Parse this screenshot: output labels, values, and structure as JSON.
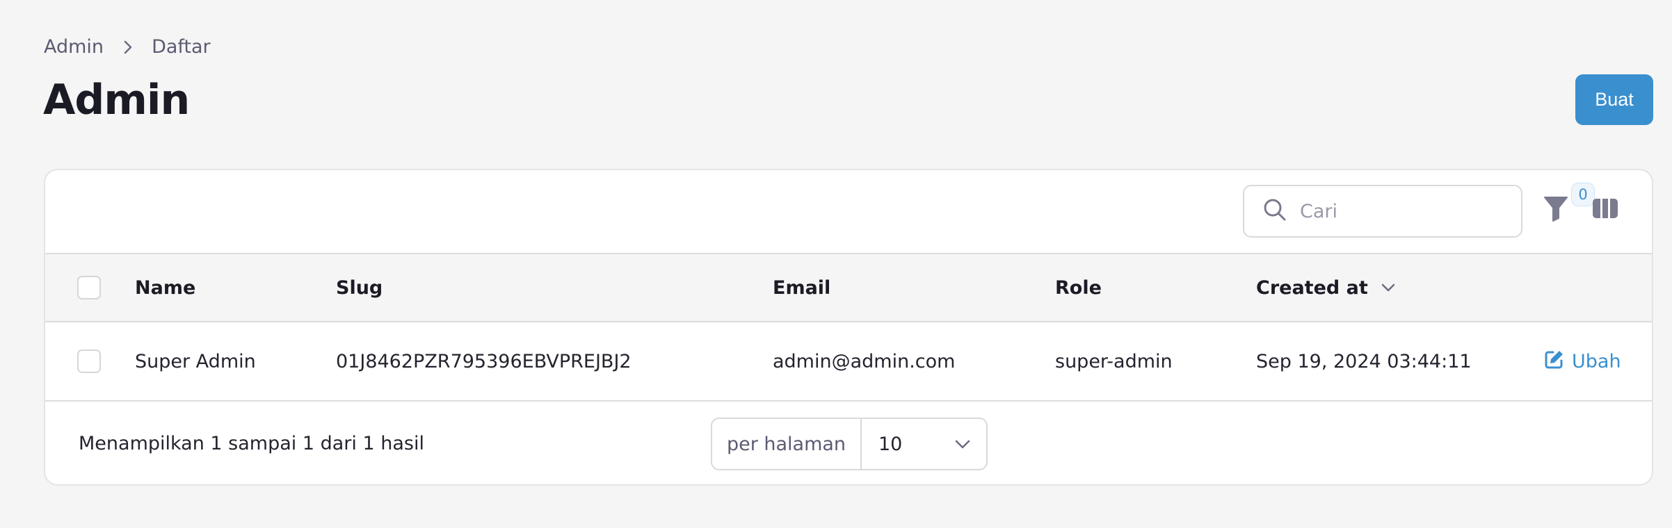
{
  "breadcrumb": {
    "items": [
      "Admin",
      "Daftar"
    ]
  },
  "header": {
    "title": "Admin",
    "create_label": "Buat"
  },
  "toolbar": {
    "search_placeholder": "Cari",
    "filter_count": "0"
  },
  "table": {
    "columns": [
      "Name",
      "Slug",
      "Email",
      "Role",
      "Created at"
    ],
    "sorted_column": "Created at",
    "rows": [
      {
        "name": "Super Admin",
        "slug": "01J8462PZR795396EBVPREJBJ2",
        "email": "admin@admin.com",
        "role": "super-admin",
        "created_at": "Sep 19, 2024 03:44:11",
        "action_label": "Ubah"
      }
    ]
  },
  "pagination": {
    "summary": "Menampilkan 1 sampai 1 dari 1 hasil",
    "per_page_label": "per halaman",
    "per_page_value": "10"
  },
  "colors": {
    "accent": "#3a8fcf",
    "background": "#f5f5f5",
    "border": "#dcdce0"
  },
  "icons": [
    "chevron-right-icon",
    "search-icon",
    "filter-icon",
    "columns-icon",
    "chevron-down-icon",
    "edit-icon"
  ]
}
